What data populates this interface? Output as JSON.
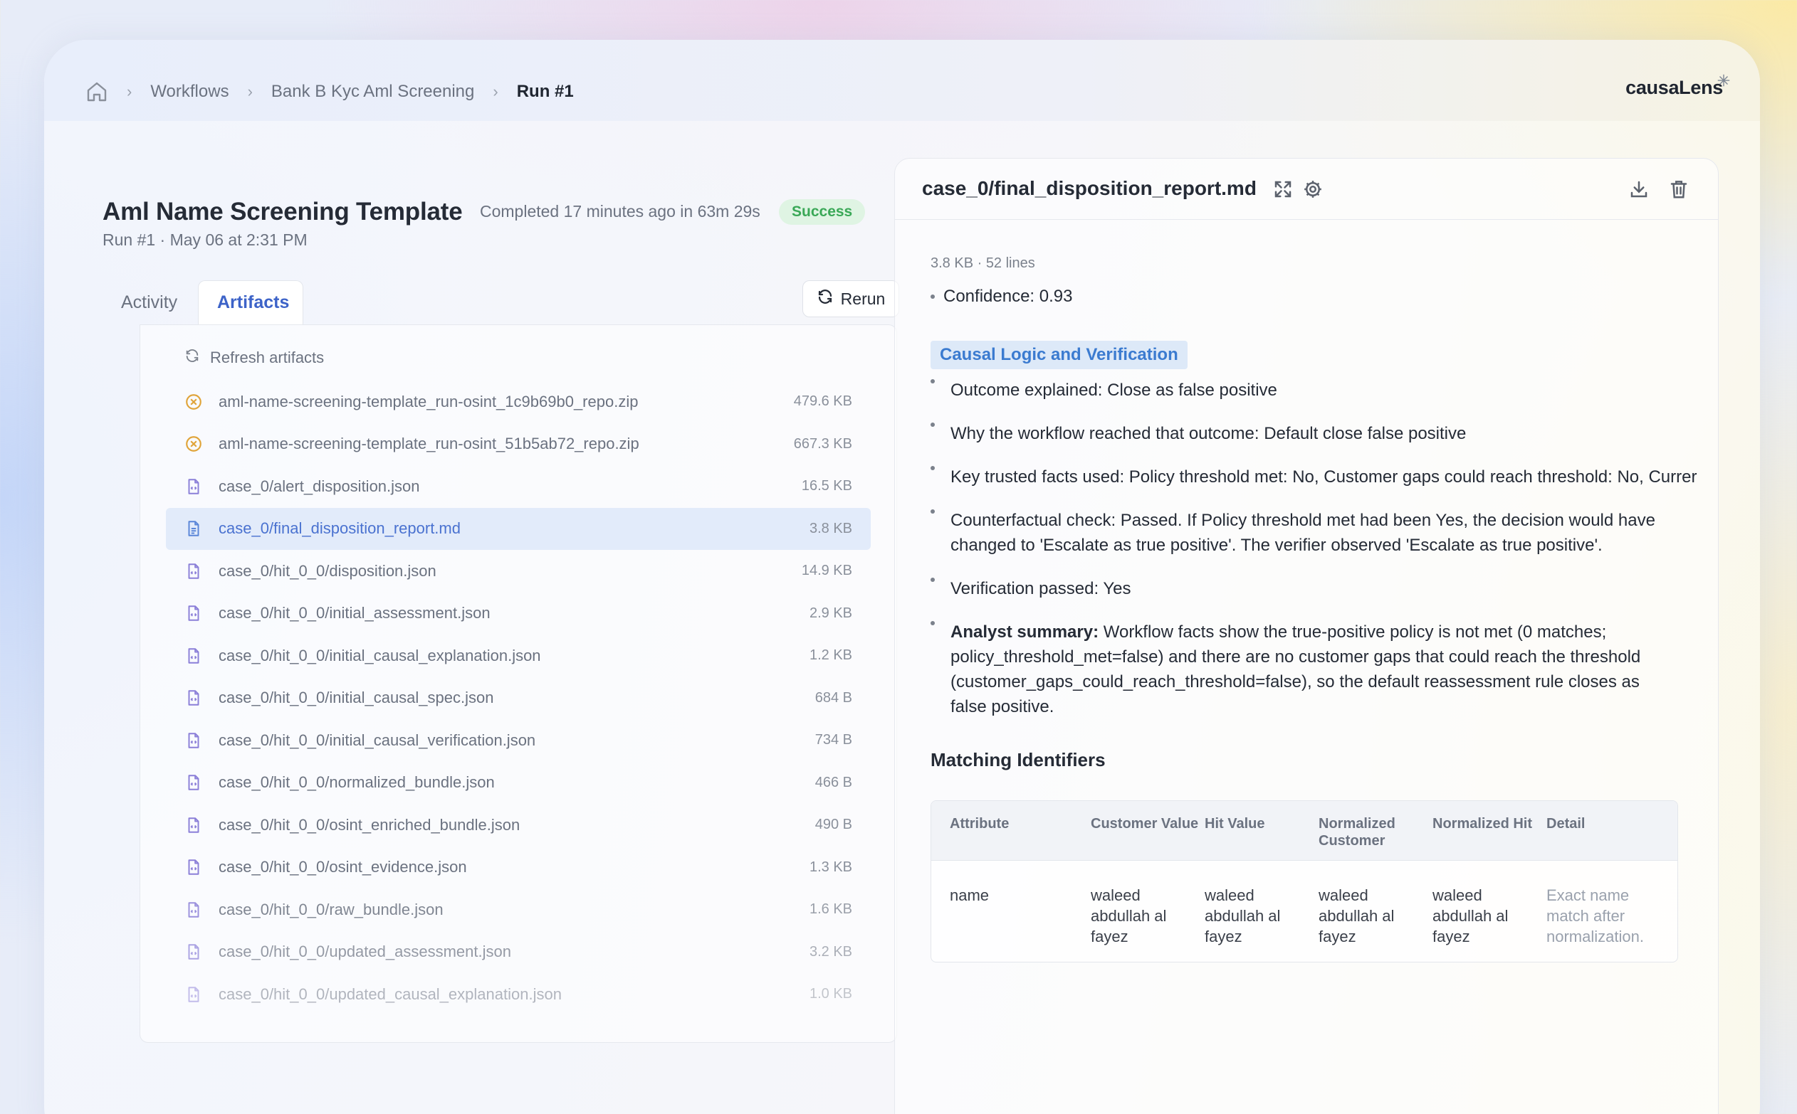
{
  "breadcrumbs": {
    "home_icon": "home-icon",
    "items": [
      "Workflows",
      "Bank B Kyc Aml Screening"
    ],
    "current": "Run #1"
  },
  "brand": "causaLens",
  "run": {
    "title": "Aml Name Screening Template",
    "subtitle": "Run #1 · May 06 at 2:31 PM",
    "completed": "Completed 17 minutes ago in 63m 29s",
    "status": "Success"
  },
  "tabs": {
    "activity": "Activity",
    "artifacts": "Artifacts"
  },
  "rerun_label": "Rerun",
  "refresh_label": "Refresh artifacts",
  "files": [
    {
      "name": "aml-name-screening-template_run-osint_1c9b69b0_repo.zip",
      "size": "479.6 KB",
      "icon": "zip-icon"
    },
    {
      "name": "aml-name-screening-template_run-osint_51b5ab72_repo.zip",
      "size": "667.3 KB",
      "icon": "zip-icon"
    },
    {
      "name": "case_0/alert_disposition.json",
      "size": "16.5 KB",
      "icon": "json-file-icon"
    },
    {
      "name": "case_0/final_disposition_report.md",
      "size": "3.8 KB",
      "icon": "doc-file-icon",
      "selected": true
    },
    {
      "name": "case_0/hit_0_0/disposition.json",
      "size": "14.9 KB",
      "icon": "json-file-icon"
    },
    {
      "name": "case_0/hit_0_0/initial_assessment.json",
      "size": "2.9 KB",
      "icon": "json-file-icon"
    },
    {
      "name": "case_0/hit_0_0/initial_causal_explanation.json",
      "size": "1.2 KB",
      "icon": "json-file-icon"
    },
    {
      "name": "case_0/hit_0_0/initial_causal_spec.json",
      "size": "684 B",
      "icon": "json-file-icon"
    },
    {
      "name": "case_0/hit_0_0/initial_causal_verification.json",
      "size": "734 B",
      "icon": "json-file-icon"
    },
    {
      "name": "case_0/hit_0_0/normalized_bundle.json",
      "size": "466 B",
      "icon": "json-file-icon"
    },
    {
      "name": "case_0/hit_0_0/osint_enriched_bundle.json",
      "size": "490 B",
      "icon": "json-file-icon"
    },
    {
      "name": "case_0/hit_0_0/osint_evidence.json",
      "size": "1.3 KB",
      "icon": "json-file-icon"
    },
    {
      "name": "case_0/hit_0_0/raw_bundle.json",
      "size": "1.6 KB",
      "icon": "json-file-icon"
    },
    {
      "name": "case_0/hit_0_0/updated_assessment.json",
      "size": "3.2 KB",
      "icon": "json-file-icon"
    },
    {
      "name": "case_0/hit_0_0/updated_causal_explanation.json",
      "size": "1.0 KB",
      "icon": "json-file-icon"
    }
  ],
  "preview": {
    "title": "case_0/final_disposition_report.md",
    "meta": "3.8 KB · 52 lines",
    "confidence": "Confidence: 0.93",
    "section": "Causal Logic and Verification",
    "bullets": [
      "Outcome explained: Close as false positive",
      "Why the workflow reached that outcome: Default close false positive",
      "Key trusted facts used: Policy threshold met: No, Customer gaps could reach threshold: No, Currer",
      "Counterfactual check: Passed. If Policy threshold met had been Yes, the decision would have changed to 'Escalate as true positive'. The verifier observed 'Escalate as true positive'.",
      "Verification passed: Yes"
    ],
    "summary_label": "Analyst summary:",
    "summary_text": " Workflow facts show the true-positive policy is not met (0 matches; policy_threshold_met=false) and there are no customer gaps that could reach the threshold (customer_gaps_could_reach_threshold=false), so the default reassessment rule closes as false positive.",
    "matching_title": "Matching Identifiers",
    "table": {
      "headers": [
        "Attribute",
        "Customer Value",
        "Hit Value",
        "Normalized Customer",
        "Normalized Hit",
        "Detail"
      ],
      "row": [
        "name",
        "waleed abdullah al fayez",
        "waleed abdullah al fayez",
        "waleed abdullah al fayez",
        "waleed abdullah al fayez",
        "Exact name match after normalization."
      ]
    }
  }
}
